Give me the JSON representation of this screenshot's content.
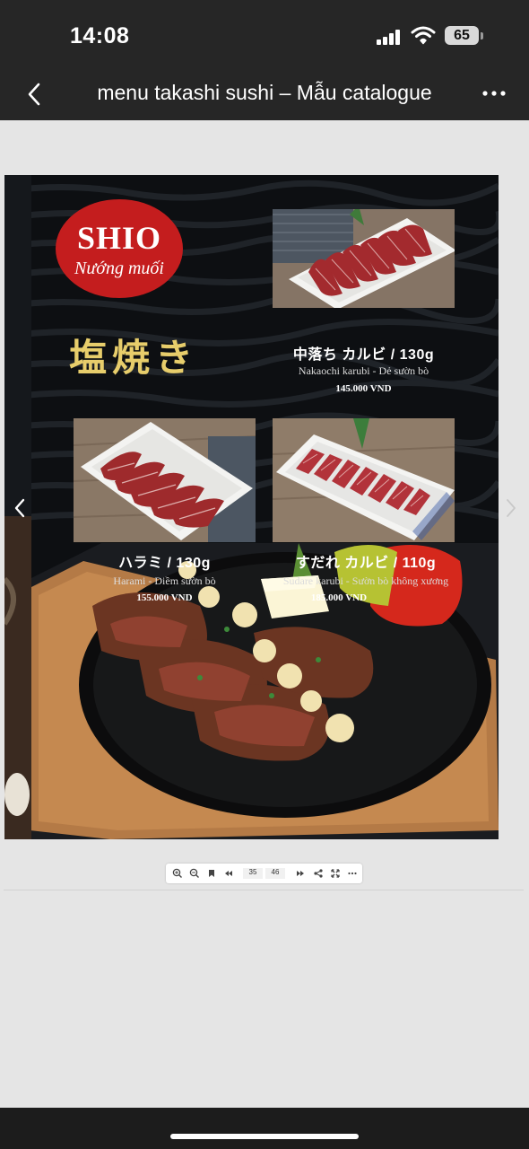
{
  "status_bar": {
    "time": "14:08",
    "battery": "65"
  },
  "nav": {
    "title": "menu takashi sushi – Mẫu catalogue"
  },
  "menu_page": {
    "badge_title": "SHIO",
    "badge_subtitle": "Nướng muối",
    "japanese_title": "塩焼き",
    "items": [
      {
        "name": "中落ち カルビ / 130g",
        "description": "Nakaochi karubi - Dẻ sườn bò",
        "price": "145.000 VND"
      },
      {
        "name": "ハラミ / 130g",
        "description": "Harami - Diềm sườn bò",
        "price": "155.000 VND"
      },
      {
        "name": "すだれ カルビ / 110g",
        "description": "Sudare karubi - Sườn bò không xương",
        "price": "185.000 VND"
      }
    ]
  },
  "toolbar": {
    "current_page": "35",
    "next_page": "46"
  },
  "colors": {
    "bars": "#262626",
    "badge_red": "#c41d1e",
    "title_gold": "#e7cd6b",
    "page_bg": "#0d0f12"
  }
}
